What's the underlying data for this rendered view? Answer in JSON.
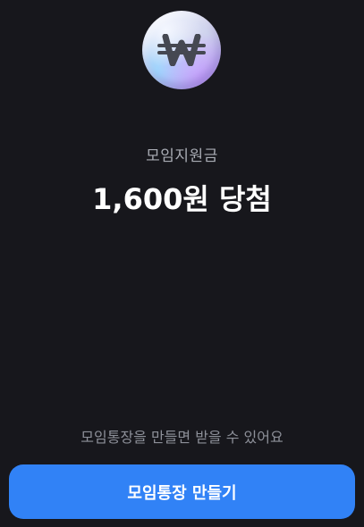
{
  "reward": {
    "icon": "won-coin-icon",
    "label": "모임지원금",
    "headline": "1,600원 당첨"
  },
  "footer": {
    "notice": "모임통장을 만들면 받을 수 있어요",
    "button_label": "모임통장 만들기",
    "button_color": "#3182f6"
  }
}
